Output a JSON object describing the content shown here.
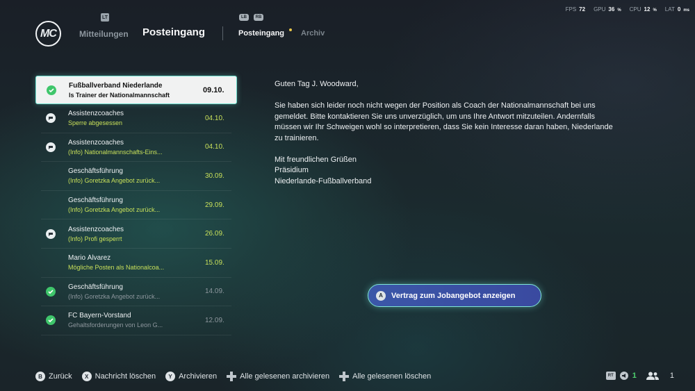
{
  "perf": [
    {
      "label": "FPS",
      "value": "72",
      "unit": ""
    },
    {
      "label": "GPU",
      "value": "36",
      "unit": "%"
    },
    {
      "label": "CPU",
      "value": "12",
      "unit": "%"
    },
    {
      "label": "LAT",
      "value": "0",
      "unit": "ms"
    }
  ],
  "header": {
    "logo": "MC",
    "nav_prev": "Mitteilungen",
    "nav_prev_badge": "LT",
    "title": "Posteingang",
    "bumper_left": "LB",
    "bumper_right": "RB",
    "tab_active": "Posteingang",
    "tab_inactive": "Archiv"
  },
  "inbox": [
    {
      "sender": "Fußballverband Niederlande",
      "subject": "ls Trainer der Nationalmannschaft",
      "date": "09.10.",
      "icon": "check-icon",
      "state": "selected"
    },
    {
      "sender": "Assistenzcoaches",
      "subject": "Sperre abgesessen",
      "date": "04.10.",
      "icon": "chat-icon",
      "state": "unread"
    },
    {
      "sender": "Assistenzcoaches",
      "subject": "(Info) Nationalmannschafts-Eins...",
      "date": "04.10.",
      "icon": "chat-icon",
      "state": "unread"
    },
    {
      "sender": "Geschäftsführung",
      "subject": "(Info) Goretzka Angebot zurück...",
      "date": "30.09.",
      "icon": "none",
      "state": "unread"
    },
    {
      "sender": "Geschäftsführung",
      "subject": "(Info) Goretzka Angebot zurück...",
      "date": "29.09.",
      "icon": "none",
      "state": "unread"
    },
    {
      "sender": "Assistenzcoaches",
      "subject": "(Info) Profi gesperrt",
      "date": "26.09.",
      "icon": "chat-icon",
      "state": "unread"
    },
    {
      "sender": "Mario Álvarez",
      "subject": "Mögliche Posten als Nationalcoa...",
      "date": "15.09.",
      "icon": "none",
      "state": "unread"
    },
    {
      "sender": "Geschäftsführung",
      "subject": "(Info) Goretzka Angebot zurück...",
      "date": "14.09.",
      "icon": "check-icon",
      "state": "read"
    },
    {
      "sender": "FC Bayern-Vorstand",
      "subject": "Gehaltsforderungen von Leon G...",
      "date": "12.09.",
      "icon": "check-icon",
      "state": "read"
    }
  ],
  "message": {
    "greeting": "Guten Tag J. Woodward,",
    "body": "Sie haben sich leider noch nicht wegen der Position als Coach der Nationalmannschaft bei uns gemeldet. Bitte kontaktieren Sie uns unverzüglich, um uns Ihre Antwort mitzuteilen. Andernfalls müssen wir Ihr Schweigen wohl so interpretieren, dass Sie kein Interesse daran haben, Niederlande zu trainieren.",
    "closing": "Mit freundlichen Grüßen",
    "sig_line1": "Präsidium",
    "sig_line2": "Niederlande-Fußballverband"
  },
  "cta": {
    "glyph": "A",
    "label": "Vertrag zum Jobangebot anzeigen"
  },
  "footer": {
    "hints": [
      {
        "glyph": "B",
        "label": "Zurück"
      },
      {
        "glyph": "X",
        "label": "Nachricht löschen"
      },
      {
        "glyph": "Y",
        "label": "Archivieren"
      },
      {
        "glyph": "dpad",
        "label": "Alle gelesenen archivieren"
      },
      {
        "glyph": "dpad",
        "label": "Alle gelesenen löschen"
      }
    ],
    "rt_glyph": "RT",
    "count_green": "1",
    "count_users": "1"
  },
  "colors": {
    "accent": "#6fe1d0",
    "highlight": "#c8e05a",
    "check": "#3fc66b",
    "cta": "#3b57a8"
  }
}
